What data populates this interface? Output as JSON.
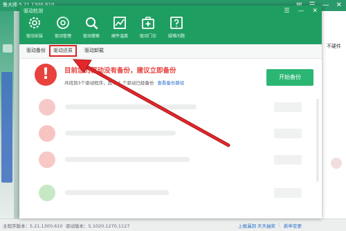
{
  "background_app": {
    "title": "鲁大师 5.21.1300.610",
    "controls": [
      "✉",
      "☰",
      "—",
      "✕"
    ],
    "right_text": "不硬件",
    "status": {
      "version": "主程序版本：5.21.1300.610",
      "driver_version": "驱动版本：5.1020.1270.1127",
      "link1": "上报漏洞",
      "link2": "天天抽奖",
      "link3": "新申变更"
    }
  },
  "dialog": {
    "title": "驱动检测",
    "controls": [
      "☰",
      "—",
      "✕"
    ],
    "toolbar": [
      {
        "label": "驱动安装",
        "icon": "gear-icon"
      },
      {
        "label": "驱动管理",
        "icon": "disc-icon"
      },
      {
        "label": "驱动搜索",
        "icon": "search-icon"
      },
      {
        "label": "硬件温度",
        "icon": "chart-icon"
      },
      {
        "label": "驱动门诊",
        "icon": "medical-kit-icon"
      },
      {
        "label": "疑难问题",
        "icon": "help-icon"
      }
    ],
    "tabs": [
      {
        "label": "驱动备份",
        "active": false
      },
      {
        "label": "驱动还原",
        "active": true
      },
      {
        "label": "驱动卸载",
        "active": false
      }
    ],
    "warning": {
      "icon_glyph": "!",
      "title": "目前您的驱动没有备份，建议立即备份",
      "subtitle": "共找到3个驱动程序，其中 1 个驱动已经备份",
      "link": "查看备份路径",
      "button": "开始备份"
    }
  },
  "colors": {
    "header_green": "#1f9e62",
    "button_green": "#2bb673",
    "warning_red": "#e8423f",
    "highlight_red": "#d91f1f"
  }
}
